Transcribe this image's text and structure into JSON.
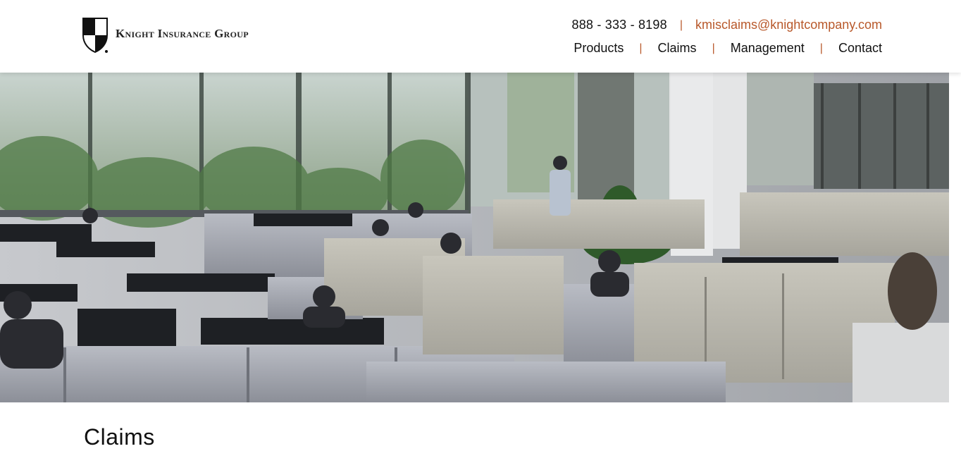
{
  "header": {
    "logo_text": "Knight Insurance Group",
    "phone": "888 - 333 - 8198",
    "email": "kmisclaims@knightcompany.com",
    "separator": "|",
    "nav": [
      {
        "label": "Products"
      },
      {
        "label": "Claims"
      },
      {
        "label": "Management"
      },
      {
        "label": "Contact"
      }
    ]
  },
  "hero": {
    "icon": "office-photo"
  },
  "main": {
    "title": "Claims"
  },
  "colors": {
    "accent": "#b8582a",
    "text": "#111111",
    "background": "#ffffff"
  }
}
